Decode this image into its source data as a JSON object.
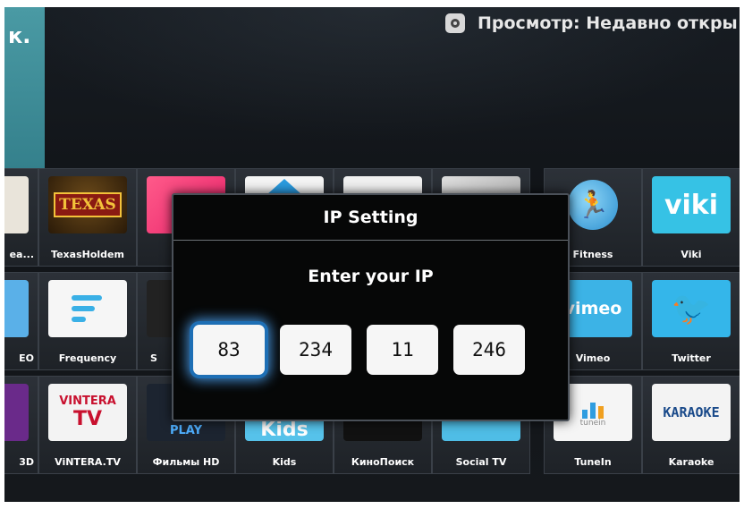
{
  "header": {
    "left_fragment": "к.",
    "viewing_label": "Просмотр: Недавно откры"
  },
  "tiles": [
    {
      "label": "ea..."
    },
    {
      "label": "TexasHoldem",
      "art_text": "TEXAS"
    },
    {
      "label": "Fitness"
    },
    {
      "label": "Viki",
      "art_text": "viki"
    },
    {
      "label": "EO"
    },
    {
      "label": "Frequency"
    },
    {
      "label": "S"
    },
    {
      "label": "Vimeo",
      "art_text": "vimeo"
    },
    {
      "label": "Twitter"
    },
    {
      "label": "3D"
    },
    {
      "label": "ViNTERA.TV",
      "art_text": "VINTERA",
      "art_text_2": "TV"
    },
    {
      "label": "Фильмы HD",
      "art_text": "PLAY"
    },
    {
      "label": "Kids",
      "art_text": "Kids"
    },
    {
      "label": "КиноПоиск"
    },
    {
      "label": "Social TV"
    },
    {
      "label": "TuneIn",
      "art_text": "tunein"
    },
    {
      "label": "Karaoke",
      "art_text": "KARAOKE"
    }
  ],
  "dialog": {
    "title": "IP Setting",
    "prompt": "Enter your IP",
    "octets": [
      "83",
      "234",
      "11",
      "246"
    ],
    "focused_octet_index": 0
  }
}
